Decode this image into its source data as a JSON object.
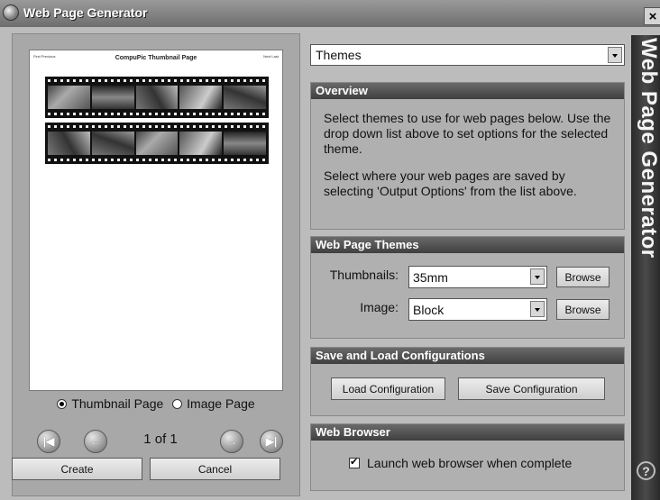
{
  "window": {
    "title": "Web Page Generator",
    "close_symbol": "×"
  },
  "preview": {
    "prev_link": "First Previous",
    "title": "CompuPic Thumbnail Page",
    "next_link": "Next Last"
  },
  "page_type": {
    "options": [
      "Thumbnail Page",
      "Image Page"
    ],
    "selected": "Thumbnail Page"
  },
  "navigation": {
    "page_count": "1 of 1"
  },
  "buttons": {
    "create": "Create",
    "cancel": "Cancel"
  },
  "option_select": {
    "value": "Themes"
  },
  "overview": {
    "header": "Overview",
    "text1": "Select themes to use for web pages below. Use the drop down list above to set options for the selected theme.",
    "text2": "Select where your web pages are saved by selecting 'Output Options' from the list above."
  },
  "themes": {
    "header": "Web Page Themes",
    "thumbnails_label": "Thumbnails:",
    "thumbnails_value": "35mm",
    "image_label": "Image:",
    "image_value": "Block",
    "browse": "Browse"
  },
  "configs": {
    "header": "Save and Load Configurations",
    "load": "Load Configuration",
    "save": "Save Configuration"
  },
  "browser": {
    "header": "Web Browser",
    "launch_label": "Launch web browser when complete",
    "launch_checked": true
  },
  "banner": {
    "text": "Web Page Generator",
    "help_symbol": "?"
  }
}
